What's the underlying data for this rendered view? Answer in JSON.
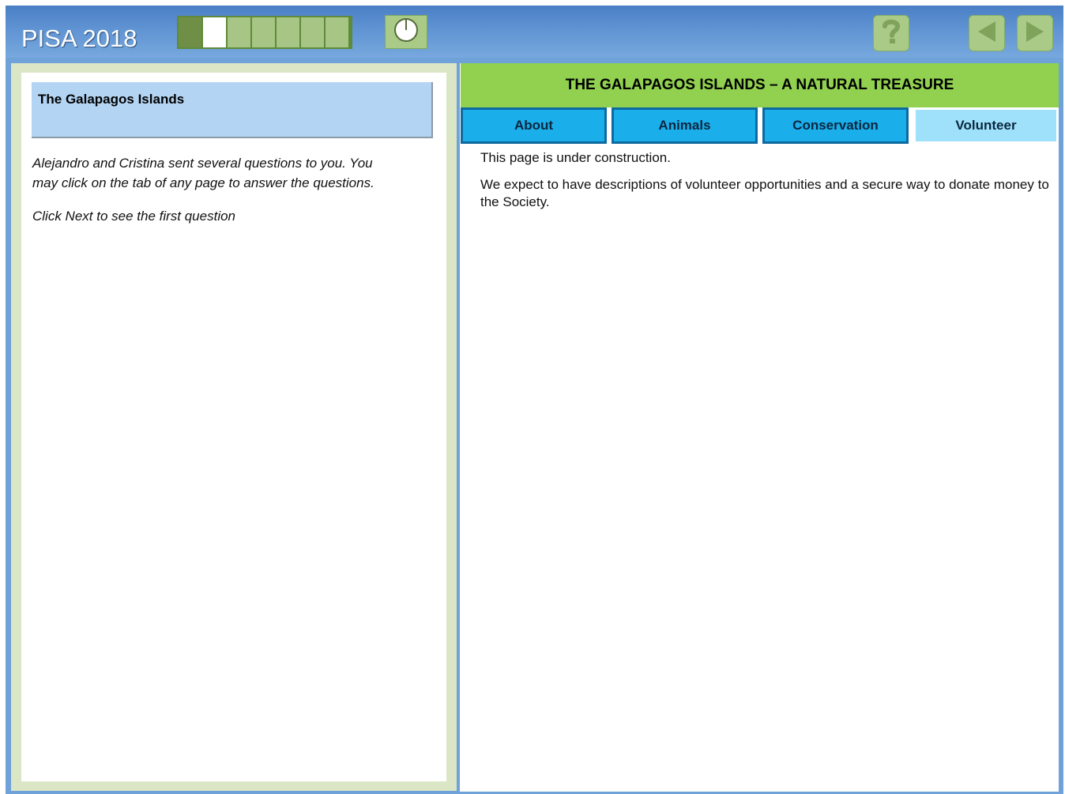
{
  "app": {
    "title": "PISA 2018",
    "progress": {
      "total_segments": 7,
      "completed": 1,
      "current_index": 1
    },
    "icons": {
      "timer": "clock-icon",
      "help": "question-mark-icon",
      "back": "back-arrow-icon",
      "next": "next-arrow-icon"
    }
  },
  "left_panel": {
    "unit_title": "The Galapagos Islands",
    "instructions": [
      "Alejandro and Cristina sent several questions to you. You may click on the tab of any page to answer the questions.",
      "Click Next to see the first question"
    ]
  },
  "website": {
    "title": "THE GALAPAGOS ISLANDS – A NATURAL TREASURE",
    "tabs": [
      {
        "label": "About",
        "active": false
      },
      {
        "label": "Animals",
        "active": false
      },
      {
        "label": "Conservation",
        "active": false
      },
      {
        "label": "Volunteer",
        "active": true
      }
    ],
    "paragraphs": [
      "This page is under construction.",
      "We expect to have descriptions of volunteer opportunities and a secure way to donate money to the Society."
    ]
  },
  "colors": {
    "header_blue": "#5f93d2",
    "green_button": "#a9cb87",
    "site_header_green": "#91d14f",
    "tab_blue": "#1aaeea",
    "active_tab": "#9fe1fa"
  }
}
